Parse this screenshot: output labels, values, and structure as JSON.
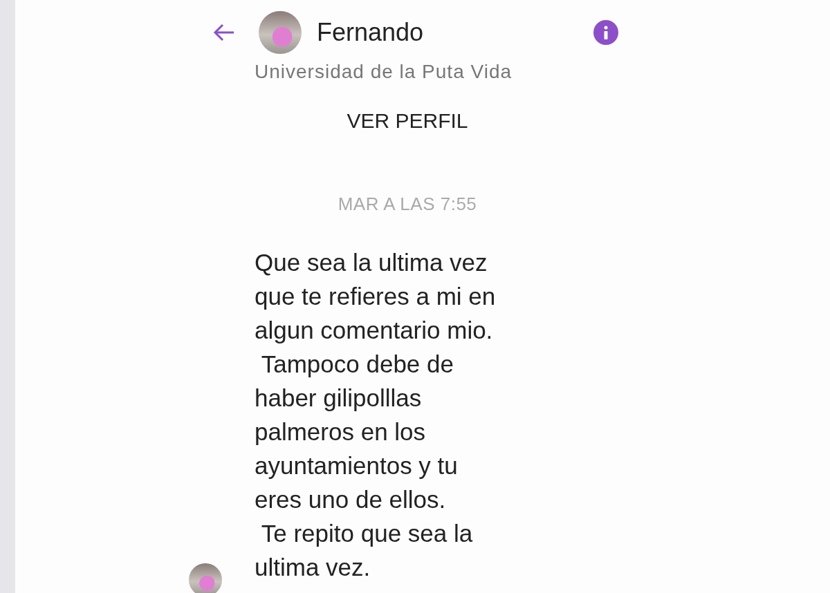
{
  "header": {
    "name": "Fernando"
  },
  "profile": {
    "subtitle": "Universidad de la Puta Vida",
    "link": "VER PERFIL"
  },
  "timestamp": "MAR A LAS 7:55",
  "messages": [
    {
      "text": "Que sea la ultima vez\nque te refieres a mi en\nalgun comentario mio.\n Tampoco debe de\nhaber gilipolllas\npalmeros en los\nayuntamientos y tu\neres uno de ellos.\n Te repito que sea la\nultima vez."
    }
  ]
}
